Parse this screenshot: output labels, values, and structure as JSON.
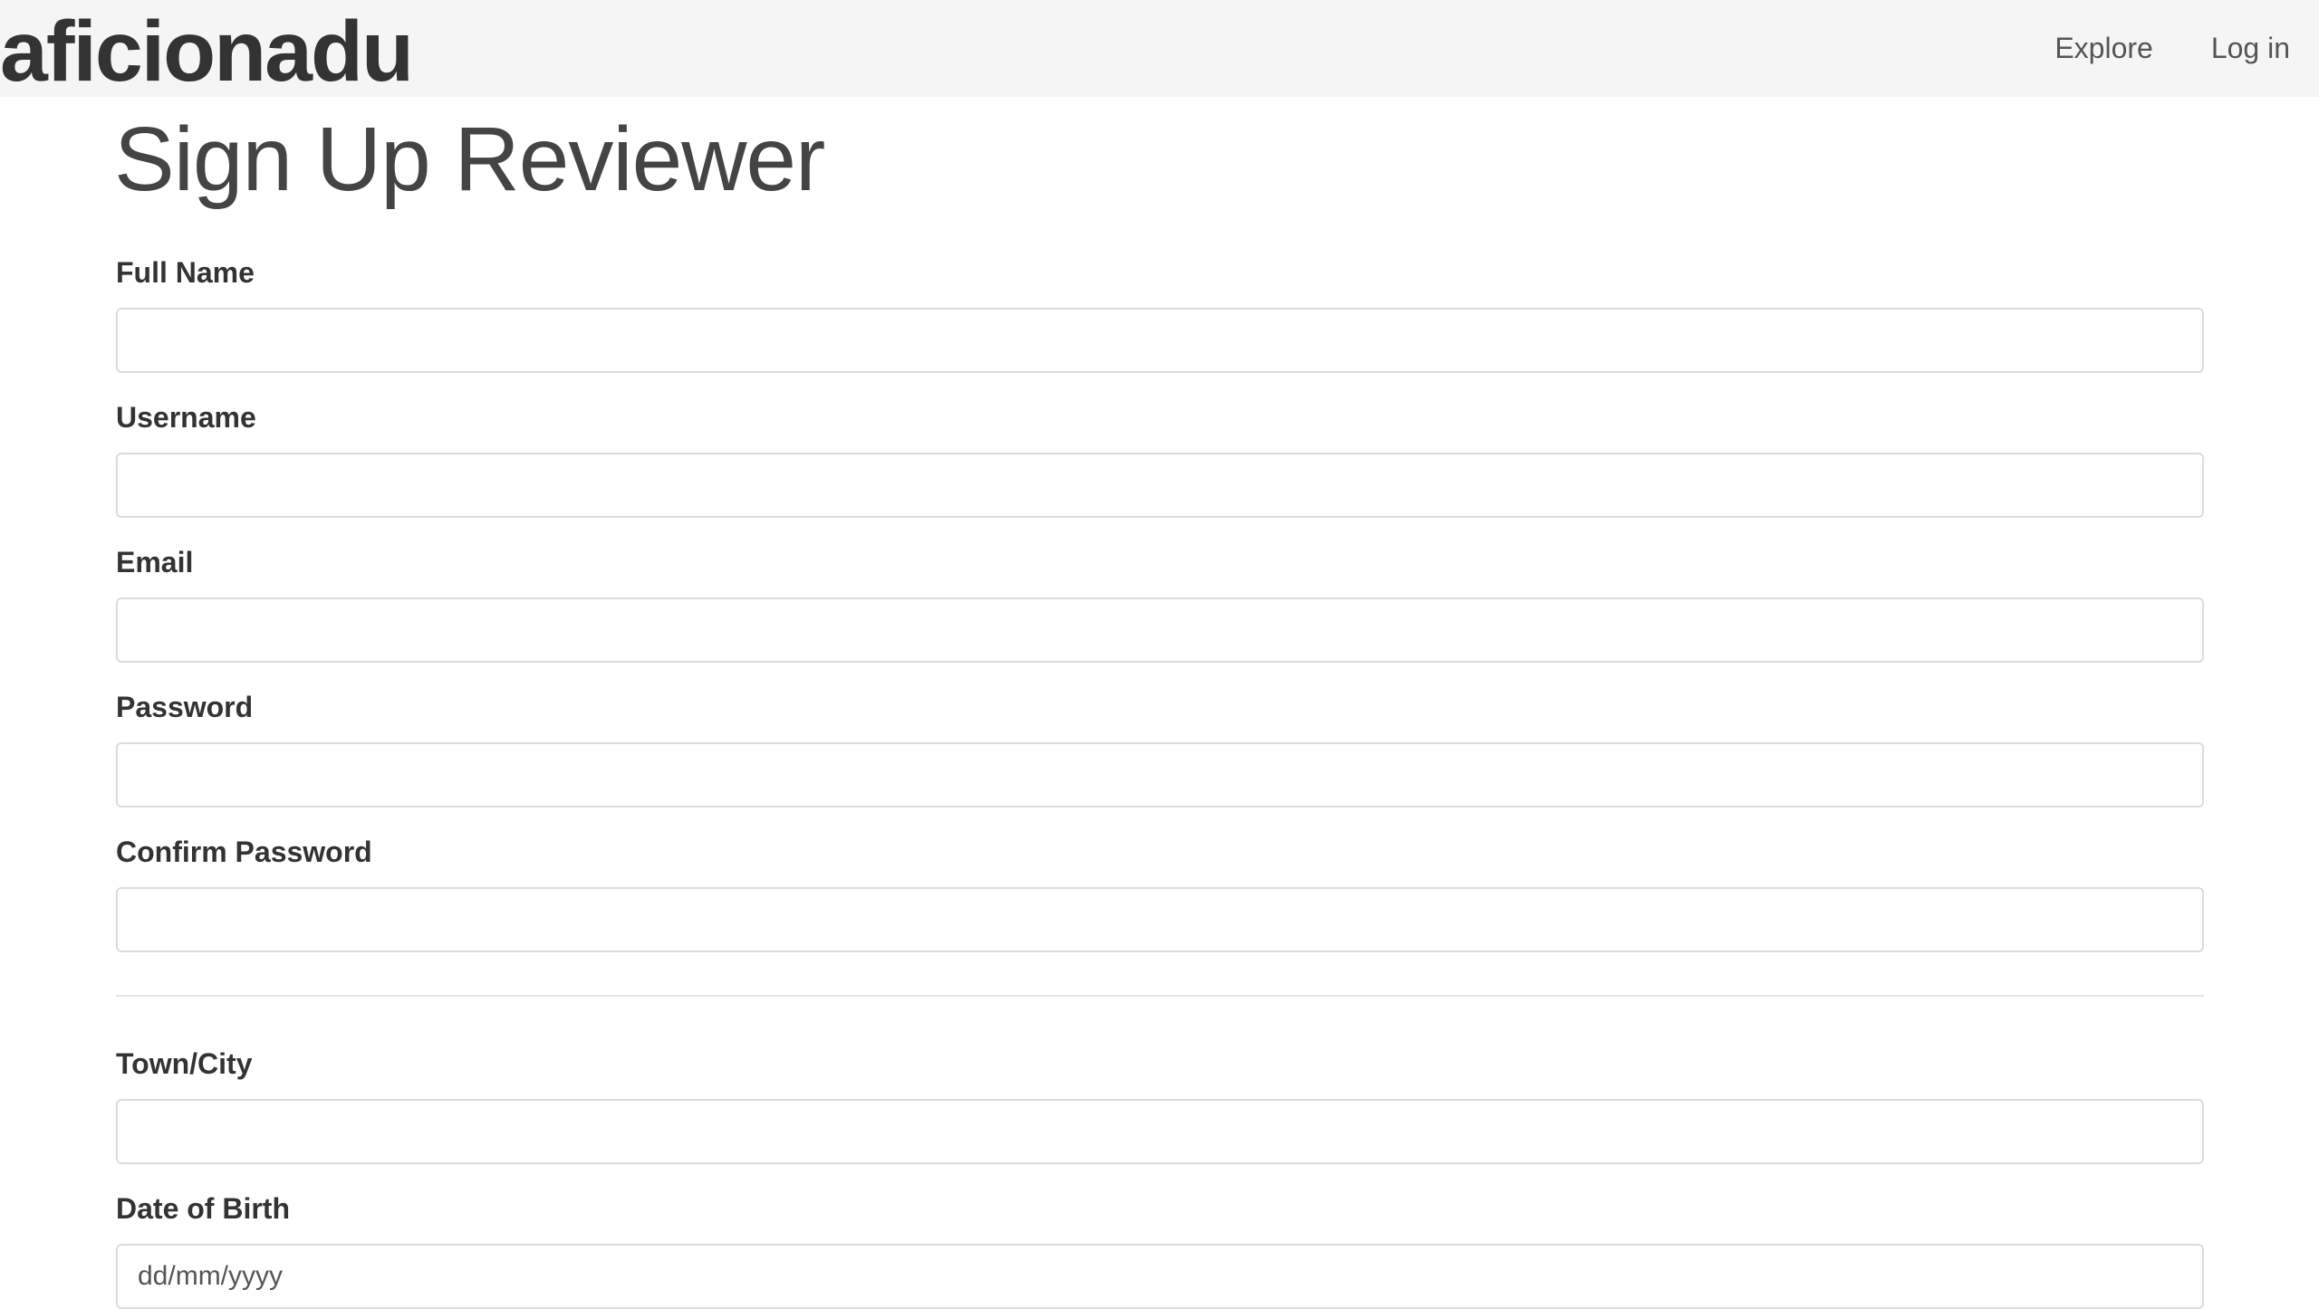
{
  "navbar": {
    "brand": "aficionadu",
    "links": [
      {
        "label": "Explore"
      },
      {
        "label": "Log in"
      }
    ]
  },
  "page": {
    "title": "Sign Up Reviewer"
  },
  "form": {
    "fields": [
      {
        "label": "Full Name",
        "value": "",
        "placeholder": ""
      },
      {
        "label": "Username",
        "value": "",
        "placeholder": ""
      },
      {
        "label": "Email",
        "value": "",
        "placeholder": ""
      },
      {
        "label": "Password",
        "value": "",
        "placeholder": ""
      },
      {
        "label": "Confirm Password",
        "value": "",
        "placeholder": ""
      },
      {
        "label": "Town/City",
        "value": "",
        "placeholder": ""
      },
      {
        "label": "Date of Birth",
        "value": "",
        "placeholder": "dd/mm/yyyy"
      }
    ]
  }
}
